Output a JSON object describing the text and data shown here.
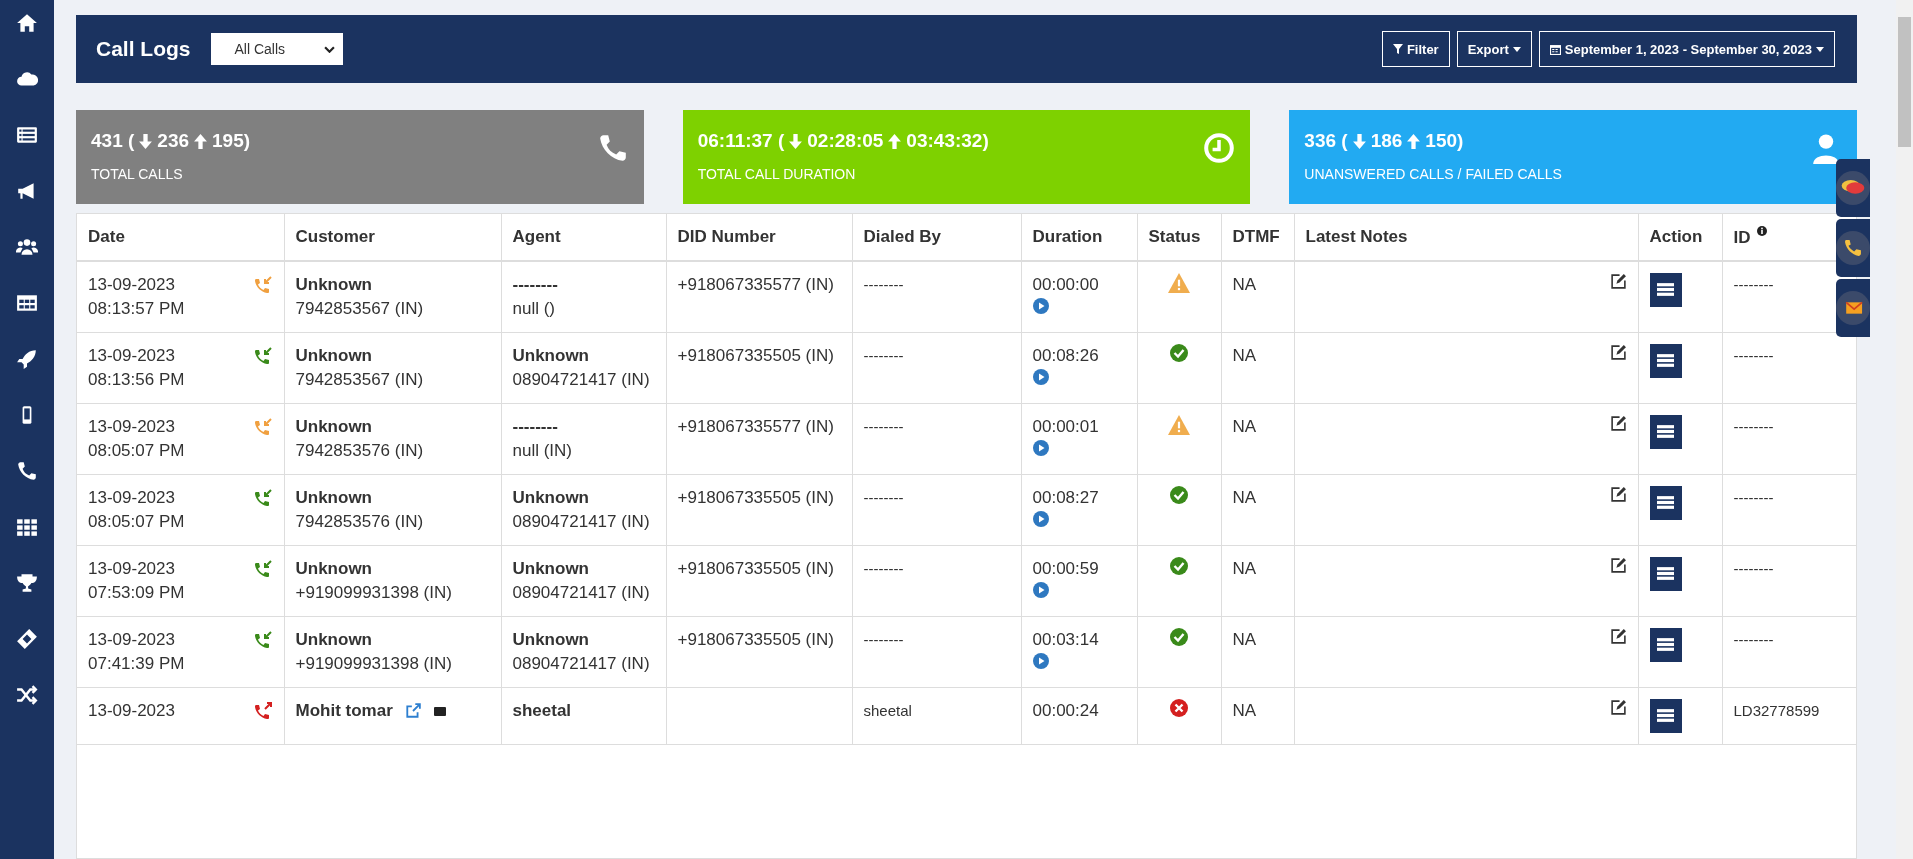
{
  "header": {
    "title": "Call Logs",
    "call_filter": {
      "value": "All Calls"
    },
    "buttons": [
      {
        "kind": "filter",
        "label": "Filter"
      },
      {
        "kind": "export",
        "label": "Export"
      },
      {
        "kind": "daterange",
        "label": "September 1, 2023 - September 30, 2023"
      }
    ]
  },
  "stats": [
    {
      "kind": "calls",
      "color": "#808080",
      "total": "431 (",
      "down": "236",
      "up": "195)",
      "label": "TOTAL CALLS"
    },
    {
      "kind": "duration",
      "color": "#7ed100",
      "total": "06:11:37 (",
      "down": "02:28:05",
      "up": "03:43:32)",
      "label": "TOTAL CALL DURATION"
    },
    {
      "kind": "unanswered",
      "color": "#22aaf2",
      "total": "336 (",
      "down": "186",
      "up": "150)",
      "label": "UNANSWERED CALLS / FAILED CALLS"
    }
  ],
  "table": {
    "columns": [
      "Date",
      "Customer",
      "Agent",
      "DID Number",
      "Dialed By",
      "Duration",
      "Status",
      "DTMF",
      "Latest Notes",
      "Action",
      "ID"
    ],
    "rows": [
      {
        "date": "13-09-2023",
        "time": "08:13:57 PM",
        "kind": "missed",
        "customer": "Unknown",
        "customer_number": "7942853567 (IN)",
        "agent": "--------",
        "agent_number": "null ()",
        "did": "+918067335577 (IN)",
        "dialed_by": "--------",
        "duration": "00:00:00",
        "dtmf": "NA",
        "id": "--------"
      },
      {
        "date": "13-09-2023",
        "time": "08:13:56 PM",
        "kind": "answered",
        "customer": "Unknown",
        "customer_number": "7942853567 (IN)",
        "agent": "Unknown",
        "agent_number": "08904721417 (IN)",
        "did": "+918067335505 (IN)",
        "dialed_by": "--------",
        "duration": "00:08:26",
        "dtmf": "NA",
        "id": "--------"
      },
      {
        "date": "13-09-2023",
        "time": "08:05:07 PM",
        "kind": "missed",
        "customer": "Unknown",
        "customer_number": "7942853576 (IN)",
        "agent": "--------",
        "agent_number": "null (IN)",
        "did": "+918067335577 (IN)",
        "dialed_by": "--------",
        "duration": "00:00:01",
        "dtmf": "NA",
        "id": "--------"
      },
      {
        "date": "13-09-2023",
        "time": "08:05:07 PM",
        "kind": "answered",
        "customer": "Unknown",
        "customer_number": "7942853576 (IN)",
        "agent": "Unknown",
        "agent_number": "08904721417 (IN)",
        "did": "+918067335505 (IN)",
        "dialed_by": "--------",
        "duration": "00:08:27",
        "dtmf": "NA",
        "id": "--------"
      },
      {
        "date": "13-09-2023",
        "time": "07:53:09 PM",
        "kind": "answered",
        "customer": "Unknown",
        "customer_number": "+919099931398 (IN)",
        "agent": "Unknown",
        "agent_number": "08904721417 (IN)",
        "did": "+918067335505 (IN)",
        "dialed_by": "--------",
        "duration": "00:00:59",
        "dtmf": "NA",
        "id": "--------"
      },
      {
        "date": "13-09-2023",
        "time": "07:41:39 PM",
        "kind": "answered",
        "customer": "Unknown",
        "customer_number": "+919099931398 (IN)",
        "agent": "Unknown",
        "agent_number": "08904721417 (IN)",
        "did": "+918067335505 (IN)",
        "dialed_by": "--------",
        "duration": "00:03:14",
        "dtmf": "NA",
        "id": "--------"
      },
      {
        "date": "13-09-2023",
        "kind": "failed",
        "customer": "Mohit tomar",
        "customer_links": true,
        "agent": "sheetal",
        "dialed_by": "sheetal",
        "duration": "00:00:24",
        "dtmf": "NA",
        "id": "LD32778599"
      }
    ]
  }
}
